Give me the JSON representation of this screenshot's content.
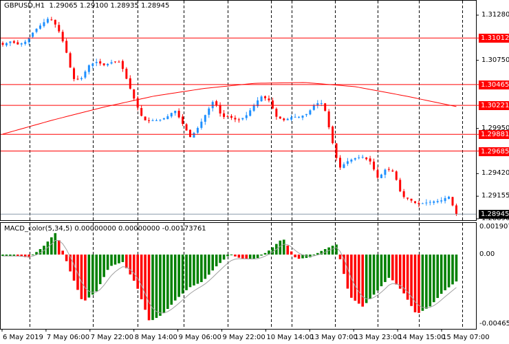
{
  "header": {
    "symbol": "GBPUSD,H1",
    "ohlc": "1.29065 1.29100 1.28935 1.28945"
  },
  "indicator": {
    "label": "MACD_color(5,34,5) 0.00000000 0.00000000 -0.00173761",
    "axis": [
      "0.0019070",
      "0.00",
      "-0.004650"
    ]
  },
  "price_axis": [
    "1.31280",
    "1.30750",
    "1.29950",
    "1.29420",
    "1.29155",
    "1.28890"
  ],
  "price_axis_values": [
    1.3128,
    1.3075,
    1.2995,
    1.2942,
    1.29155,
    1.2889
  ],
  "levels": [
    {
      "label": "1.31012",
      "value": 1.31012
    },
    {
      "label": "1.30465",
      "value": 1.30465
    },
    {
      "label": "1.30221",
      "value": 1.30221
    },
    {
      "label": "1.29881",
      "value": 1.29881
    },
    {
      "label": "1.29685",
      "value": 1.29685
    }
  ],
  "current_price": {
    "label": "1.28945",
    "value": 1.28945
  },
  "time_axis": [
    "6 May 2019",
    "7 May 06:00",
    "7 May 22:00",
    "8 May 14:00",
    "9 May 06:00",
    "9 May 22:00",
    "10 May 14:00",
    "13 May 07:00",
    "13 May 23:00",
    "14 May 15:00",
    "15 May 07:00"
  ],
  "colors": {
    "bull": "#1e90ff",
    "bear": "#ff0000",
    "level": "#ff0000",
    "ma": "#ff0000",
    "hist_up": "#008000",
    "hist_down": "#ff0000",
    "signal": "#a0a0a0"
  },
  "chart_data": {
    "type": "candlestick",
    "price_range": [
      1.2889,
      1.3128
    ],
    "macd_range": [
      -0.00465,
      0.001907
    ],
    "close_keypoints": [
      1.30933,
      1.30973,
      1.30933,
      1.30973,
      1.31094,
      1.31175,
      1.31256,
      1.31135,
      1.30893,
      1.3053,
      1.3053,
      1.30691,
      1.30731,
      1.30691,
      1.30731,
      1.30731,
      1.30489,
      1.30247,
      1.30045,
      1.30045,
      1.30045,
      1.30086,
      1.30166,
      1.30005,
      1.29844,
      1.29965,
      1.30126,
      1.30287,
      1.30086,
      1.30086,
      1.30045,
      1.30086,
      1.30207,
      1.30328,
      1.30287,
      1.30086,
      1.30045,
      1.30086,
      1.30086,
      1.30126,
      1.30247,
      1.30247,
      1.29844,
      1.2948,
      1.29561,
      1.29601,
      1.29618,
      1.29561,
      1.29359,
      1.2948,
      1.2944,
      1.29158,
      1.29117,
      1.29061,
      1.29077,
      1.29093,
      1.29101,
      1.29158,
      1.28945
    ],
    "ma_keypoints": [
      1.29884,
      1.3005,
      1.302,
      1.3033,
      1.3042,
      1.3048,
      1.30489,
      1.3044,
      1.3033,
      1.30207
    ],
    "macd_keypoints": [
      -0.0001,
      -0.0001,
      -0.0002,
      0.0005,
      0.0015,
      -0.001,
      -0.0032,
      -0.0025,
      -0.0008,
      -0.0005,
      -0.002,
      -0.0045,
      -0.004,
      -0.003,
      -0.0022,
      -0.0018,
      -0.0008,
      0.0,
      -0.0003,
      -0.0003,
      0.0003,
      0.0011,
      -0.0003,
      -0.0002,
      0.0003,
      0.0007,
      -0.0028,
      -0.0035,
      -0.0025,
      -0.0015,
      -0.0025,
      -0.004,
      -0.0035,
      -0.0025,
      -0.0018
    ]
  }
}
